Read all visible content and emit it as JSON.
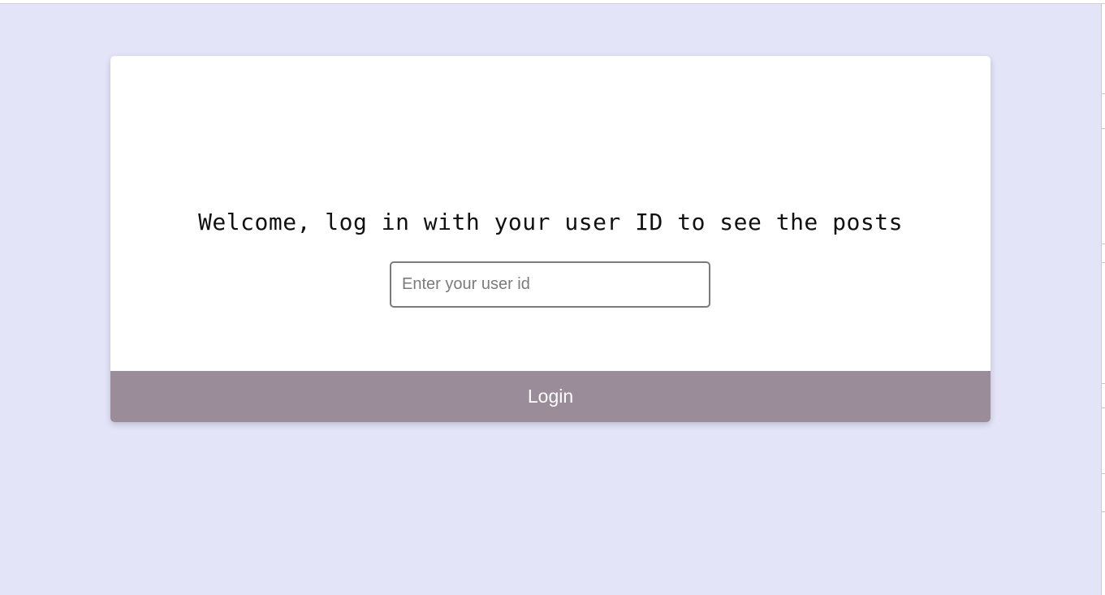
{
  "login": {
    "welcome_text": "Welcome, log in with your user ID to see the posts",
    "userid_placeholder": "Enter your user id",
    "userid_value": "",
    "login_label": "Login"
  },
  "colors": {
    "page_background": "#e3e4f8",
    "card_background": "#ffffff",
    "login_button": "#9a8c99",
    "login_text": "#ffffff",
    "input_border": "#7d7a7e"
  }
}
